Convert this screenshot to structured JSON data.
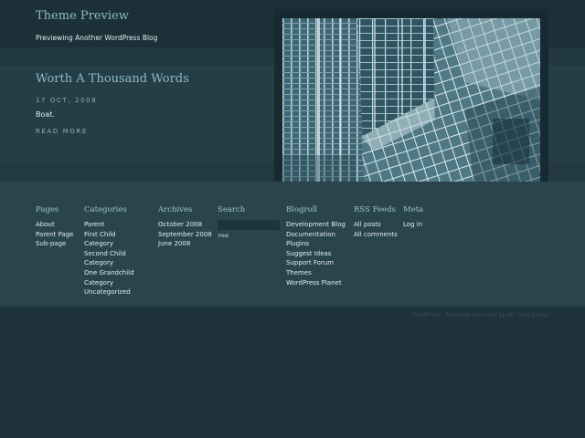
{
  "header": {
    "site_title": "Theme Preview",
    "site_description": "Previewing Another WordPress Blog"
  },
  "post": {
    "title": "Worth A Thousand Words",
    "date": "17 OCT, 2008",
    "excerpt": "Boat.",
    "read_more": "READ MORE"
  },
  "widgets": {
    "pages": {
      "title": "Pages",
      "items": [
        "About",
        "Parent Page",
        "Sub-page"
      ]
    },
    "categories": {
      "title": "Categories",
      "items": [
        "Parent",
        "First Child",
        "Category",
        "Second Child",
        "Category",
        "One Grandchild",
        "Category",
        "Uncategorized"
      ]
    },
    "archives": {
      "title": "Archives",
      "items": [
        "October 2008",
        "September 2008",
        "June 2008"
      ]
    },
    "search": {
      "title": "Search",
      "value": "",
      "button_label": "Find"
    },
    "blogroll": {
      "title": "Blogroll",
      "items": [
        "Development Blog",
        "Documentation",
        "Plugins",
        "Suggest Ideas",
        "Support Forum",
        "Themes",
        "WordPress Planet"
      ]
    },
    "rss": {
      "title": "RSS Feeds",
      "items": [
        "All posts",
        "All comments"
      ]
    },
    "meta": {
      "title": "Meta",
      "items": [
        "Log in"
      ]
    }
  },
  "footer": {
    "credits": "WordPress · Template provided by Mr. Goal Design"
  },
  "colors": {
    "background": "#1d323b",
    "post_band": "#243d46",
    "widget_band": "#29444d",
    "heading": "#8fb9c0",
    "text": "#e2ecee"
  }
}
